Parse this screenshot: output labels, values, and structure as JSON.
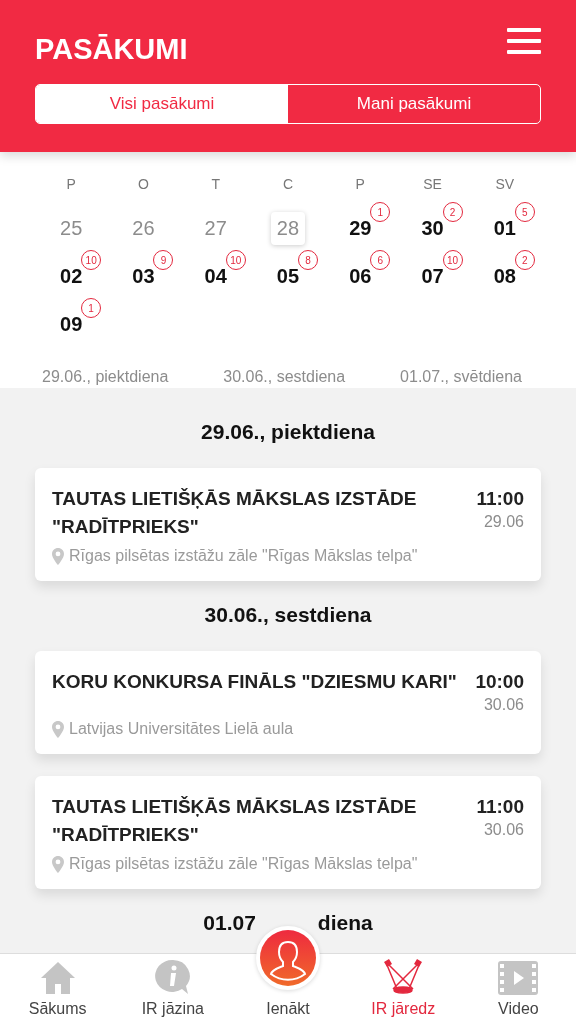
{
  "header": {
    "title": "PASĀKUMI"
  },
  "tabs": [
    {
      "label": "Visi pasākumi",
      "selected": true
    },
    {
      "label": "Mani pasākumi",
      "selected": false
    }
  ],
  "calendar": {
    "weekdays": [
      "P",
      "O",
      "T",
      "C",
      "P",
      "SE",
      "SV"
    ],
    "days": [
      {
        "day": "25",
        "past": true,
        "today": false
      },
      {
        "day": "26",
        "past": true,
        "today": false
      },
      {
        "day": "27",
        "past": true,
        "today": false
      },
      {
        "day": "28",
        "past": true,
        "today": true
      },
      {
        "day": "29",
        "past": false,
        "today": false,
        "count": "1"
      },
      {
        "day": "30",
        "past": false,
        "today": false,
        "count": "2"
      },
      {
        "day": "01",
        "past": false,
        "today": false,
        "count": "5"
      },
      {
        "day": "02",
        "past": false,
        "today": false,
        "count": "10"
      },
      {
        "day": "03",
        "past": false,
        "today": false,
        "count": "9"
      },
      {
        "day": "04",
        "past": false,
        "today": false,
        "count": "10"
      },
      {
        "day": "05",
        "past": false,
        "today": false,
        "count": "8"
      },
      {
        "day": "06",
        "past": false,
        "today": false,
        "count": "6"
      },
      {
        "day": "07",
        "past": false,
        "today": false,
        "count": "10"
      },
      {
        "day": "08",
        "past": false,
        "today": false,
        "count": "2"
      },
      {
        "day": "09",
        "past": false,
        "today": false,
        "count": "1"
      }
    ]
  },
  "date_tabs": [
    "29.06., piektdiena",
    "30.06., sestdiena",
    "01.07., svētdiena"
  ],
  "sections": [
    {
      "heading": "29.06., piektdiena",
      "events": [
        {
          "title": "TAUTAS LIETIŠĶĀS MĀKSLAS IZSTĀDE \"RADĪTPRIEKS\"",
          "time": "11:00",
          "date": "29.06",
          "location": "Rīgas pilsētas izstāžu zāle \"Rīgas Mākslas telpa\""
        }
      ]
    },
    {
      "heading": "30.06., sestdiena",
      "events": [
        {
          "title": "KORU KONKURSA FINĀLS \"DZIESMU KARI\"",
          "time": "10:00",
          "date": "30.06",
          "location": "Latvijas Universitātes Lielā aula"
        },
        {
          "title": "TAUTAS LIETIŠĶĀS MĀKSLAS IZSTĀDE \"RADĪTPRIEKS\"",
          "time": "11:00",
          "date": "30.06",
          "location": "Rīgas pilsētas izstāžu zāle \"Rīgas Mākslas telpa\""
        }
      ]
    }
  ],
  "partial_heading": [
    "01.07",
    "diena"
  ],
  "nav": [
    {
      "kind": "home",
      "label": "Sākums",
      "selected": false
    },
    {
      "kind": "info",
      "label": "IR jāzina",
      "selected": false
    },
    {
      "kind": "login",
      "label": "Ienākt",
      "selected": false
    },
    {
      "kind": "spotlight",
      "label": "IR jāredz",
      "selected": true
    },
    {
      "kind": "video",
      "label": "Video",
      "selected": false
    }
  ]
}
